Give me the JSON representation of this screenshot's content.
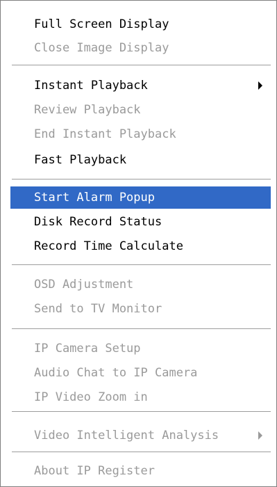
{
  "menu": {
    "items": [
      {
        "label": "Full Screen Display",
        "enabled": true
      },
      {
        "label": "Close Image Display",
        "enabled": false
      },
      {
        "label": "Instant Playback",
        "enabled": true,
        "submenu": true
      },
      {
        "label": "Review Playback",
        "enabled": false
      },
      {
        "label": "End Instant Playback",
        "enabled": false
      },
      {
        "label": "Fast Playback",
        "enabled": true
      },
      {
        "label": "Start Alarm Popup",
        "enabled": true,
        "highlighted": true
      },
      {
        "label": "Disk Record Status",
        "enabled": true
      },
      {
        "label": "Record Time Calculate",
        "enabled": true
      },
      {
        "label": "OSD Adjustment",
        "enabled": false
      },
      {
        "label": "Send to TV Monitor",
        "enabled": false
      },
      {
        "label": "IP Camera Setup",
        "enabled": false
      },
      {
        "label": "Audio Chat to IP Camera",
        "enabled": false
      },
      {
        "label": "IP Video Zoom in",
        "enabled": false
      },
      {
        "label": "Video Intelligent Analysis",
        "enabled": false,
        "submenu": true
      },
      {
        "label": "About IP Register",
        "enabled": false
      }
    ]
  },
  "colors": {
    "highlight_bg": "#3169c6",
    "highlight_text": "#ffffff",
    "enabled_text": "#000000",
    "disabled_text": "#9a9a9a"
  }
}
